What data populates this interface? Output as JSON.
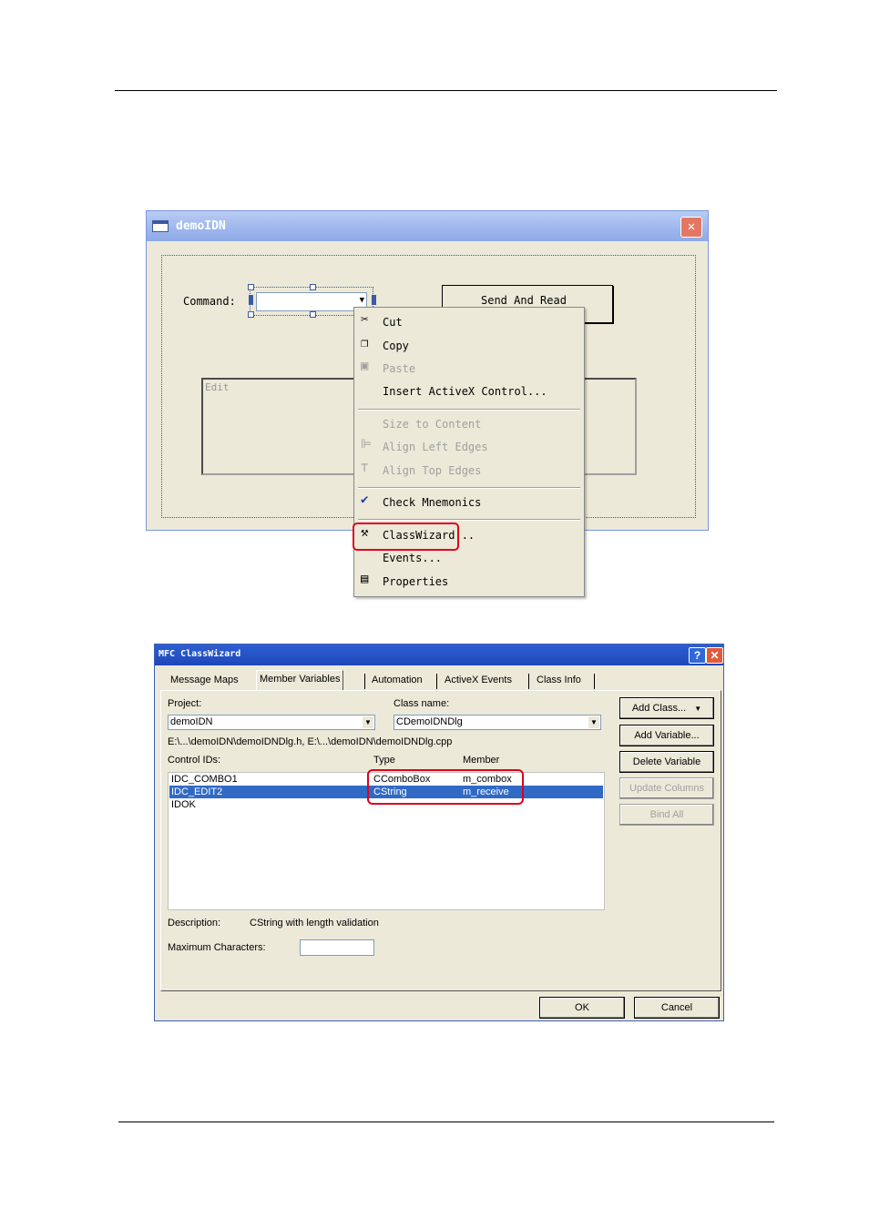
{
  "demo": {
    "title": "demoIDN",
    "close_glyph": "✕",
    "command_label": "Command:",
    "send_label": "Send And Read",
    "edit_placeholder": "Edit"
  },
  "context_menu": {
    "items": [
      {
        "label": "Cut",
        "enabled": true,
        "icon": "scissors-icon"
      },
      {
        "label": "Copy",
        "enabled": true,
        "icon": "copy-icon"
      },
      {
        "label": "Paste",
        "enabled": false,
        "icon": "paste-icon"
      },
      {
        "label": "Insert ActiveX Control...",
        "enabled": true
      },
      {
        "label": "Size to Content",
        "enabled": false
      },
      {
        "label": "Align Left Edges",
        "enabled": false,
        "icon": "align-left-icon"
      },
      {
        "label": "Align Top Edges",
        "enabled": false,
        "icon": "align-top-icon"
      },
      {
        "label": "Check Mnemonics",
        "enabled": true,
        "icon": "check-mnemonics-icon"
      },
      {
        "label": "ClassWizard...",
        "enabled": true,
        "icon": "classwizard-icon"
      },
      {
        "label": "Events...",
        "enabled": true
      },
      {
        "label": "Properties",
        "enabled": true,
        "icon": "properties-icon"
      }
    ]
  },
  "wizard": {
    "title": "MFC ClassWizard",
    "help_glyph": "?",
    "close_glyph": "✕",
    "tabs": [
      "Message Maps",
      "Member Variables",
      "Automation",
      "ActiveX Events",
      "Class Info"
    ],
    "active_tab": "Member Variables",
    "project_label": "Project:",
    "project_value": "demoIDN",
    "class_label": "Class name:",
    "class_value": "CDemoIDNDlg",
    "path": "E:\\...\\demoIDN\\demoIDNDlg.h, E:\\...\\demoIDN\\demoIDNDlg.cpp",
    "col_ids": "Control IDs:",
    "col_type": "Type",
    "col_member": "Member",
    "rows": [
      {
        "id": "IDC_COMBO1",
        "type": "CComboBox",
        "member": "m_combox"
      },
      {
        "id": "IDC_EDIT2",
        "type": "CString",
        "member": "m_receive"
      },
      {
        "id": "IDOK",
        "type": "",
        "member": ""
      }
    ],
    "selected_row": 1,
    "buttons": {
      "add_class": "Add Class...",
      "add_variable": "Add Variable...",
      "delete_variable": "Delete Variable",
      "update_columns": "Update Columns",
      "bind_all": "Bind All",
      "ok": "OK",
      "cancel": "Cancel"
    },
    "description_label": "Description:",
    "description_value": "CString with length validation",
    "max_chars_label": "Maximum Characters:",
    "max_chars_value": ""
  },
  "colors": {
    "highlight_marker": "#e0001a",
    "selection": "#316ac5",
    "dialog_face": "#ece9d8"
  }
}
